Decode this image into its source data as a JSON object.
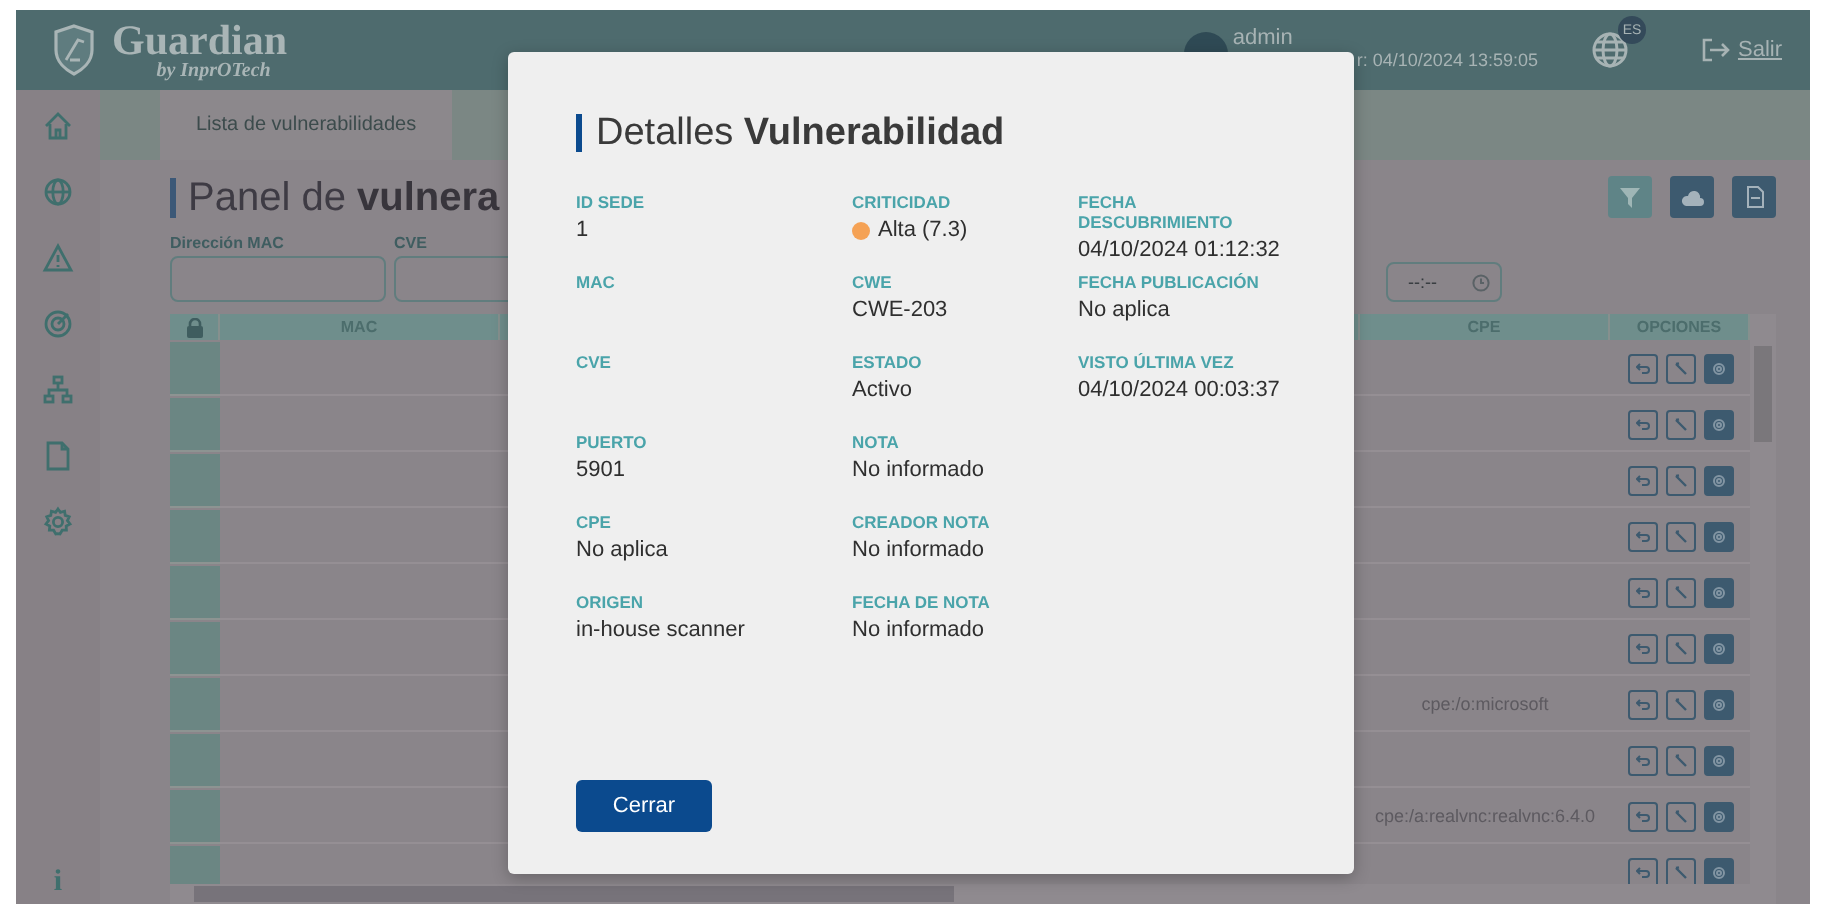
{
  "header": {
    "brand": "Guardian",
    "tagline": "by InprOTech",
    "user": "admin",
    "last_access": "r: 04/10/2024 13:59:05",
    "language": "ES",
    "logout": "Salir"
  },
  "sidebar": {
    "items": [
      {
        "kind": "home"
      },
      {
        "kind": "globe"
      },
      {
        "kind": "warning"
      },
      {
        "kind": "radar"
      },
      {
        "kind": "network"
      },
      {
        "kind": "document"
      },
      {
        "kind": "settings"
      }
    ],
    "footer": "i"
  },
  "tabs": [
    {
      "label": "Lista de vulnerabilidades",
      "selected": true
    }
  ],
  "panel": {
    "title": "Panel de **vulnera**",
    "filters": [
      {
        "label": "Dirección MAC"
      },
      {
        "label": "CVE"
      }
    ],
    "time_field": {
      "placeholder": "--:--"
    }
  },
  "table": {
    "columns": [
      "MAC",
      "CPE",
      "OPCIONES"
    ],
    "rows": [
      {},
      {},
      {},
      {},
      {},
      {},
      {
        "cpe": "cpe:/o:microsoft"
      },
      {},
      {
        "cpe": "cpe:/a:realvnc:realvnc:6.4.0"
      },
      {}
    ]
  },
  "modal": {
    "title": "Detalles **Vulnerabilidad**",
    "columns": [
      [
        {
          "label": "ID SEDE",
          "value": "1"
        },
        {
          "label": "MAC"
        },
        {
          "label": "CVE"
        },
        {
          "label": "PUERTO",
          "value": "5901"
        },
        {
          "label": "CPE",
          "value": "No aplica"
        },
        {
          "label": "ORIGEN",
          "value": "in-house scanner"
        }
      ],
      [
        {
          "label": "CRITICIDAD",
          "value": "Alta (7.3)",
          "color": "#f5a255"
        },
        {
          "label": "CWE",
          "value": "CWE-203"
        },
        {
          "label": "ESTADO",
          "value": "Activo"
        },
        {
          "label": "NOTA",
          "value": "No informado"
        },
        {
          "label": "CREADOR NOTA",
          "value": "No informado"
        },
        {
          "label": "FECHA DE NOTA",
          "value": "No informado"
        }
      ],
      [
        {
          "label": "FECHA DESCUBRIMIENTO",
          "value": "04/10/2024 01:12:32"
        },
        {
          "label": "FECHA PUBLICACIÓN",
          "value": "No aplica"
        },
        {
          "label": "VISTO ÚLTIMA VEZ",
          "value": "04/10/2024 00:03:37"
        }
      ]
    ],
    "button": "Cerrar"
  }
}
